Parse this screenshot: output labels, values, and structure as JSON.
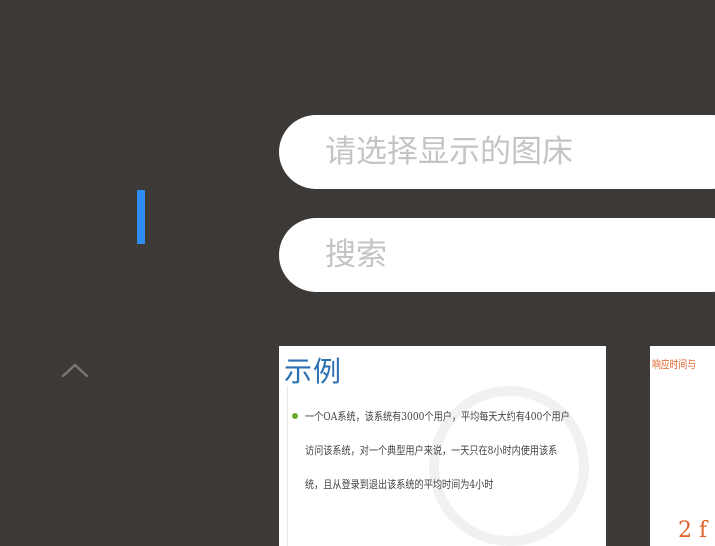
{
  "sidebar": {
    "active_indicator_color": "#2f8cf0",
    "collapse_icon": "chevron-up-icon"
  },
  "filters": {
    "bed_select_placeholder": "请选择显示的图床",
    "search_placeholder": "搜索"
  },
  "gallery": {
    "items": [
      {
        "title": "示例",
        "lines": [
          "一个OA系统，该系统有3000个用户，平均每天大约有400个用户",
          "访问该系统，对一个典型用户来说，一天只在8小时内使用该系",
          "统，且从登录到退出该系统的平均时间为4小时"
        ]
      },
      {
        "title": "响应时间与",
        "mark": "2 f"
      }
    ]
  },
  "colors": {
    "background": "#3c3936",
    "accent": "#2f8cf0"
  }
}
